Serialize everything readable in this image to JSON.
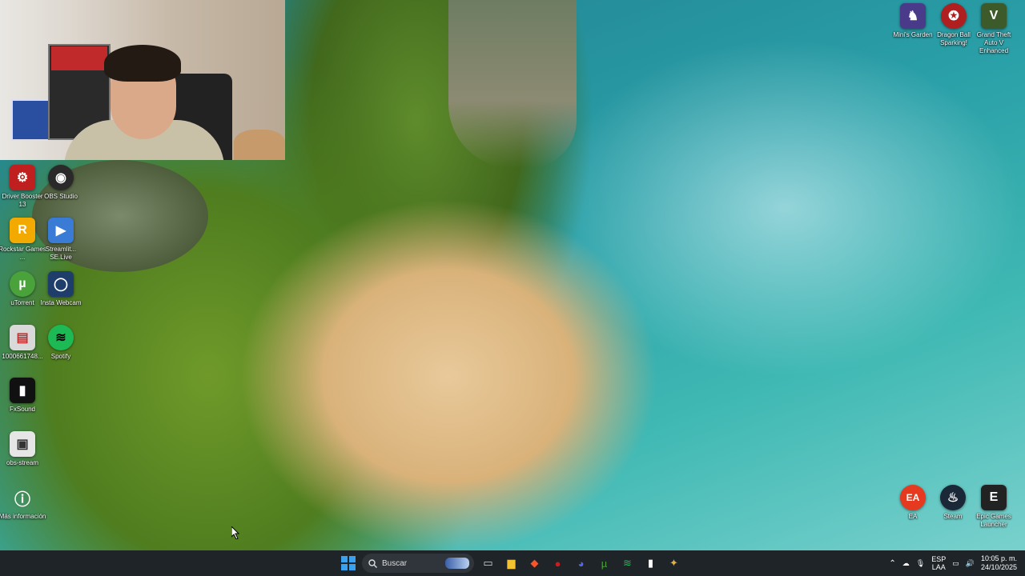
{
  "desktop_icons_left": [
    {
      "id": "driver-booster",
      "label": "Driver Booster 13",
      "icon": "gear-icon",
      "color": "#c01f1f",
      "glyph": "⚙"
    },
    {
      "id": "obs-studio",
      "label": "OBS Studio",
      "icon": "obs-icon",
      "color": "#2a2a2a",
      "glyph": "◉"
    },
    {
      "id": "rockstar",
      "label": "Rockstar Games ...",
      "icon": "rockstar-icon",
      "color": "#f2a900",
      "glyph": "R"
    },
    {
      "id": "streamlabs",
      "label": "Streamlit... SE.Live",
      "icon": "streamlabs-icon",
      "color": "#3a7bd5",
      "glyph": "▶"
    },
    {
      "id": "utorrent",
      "label": "uTorrent",
      "icon": "utorrent-icon",
      "color": "#4aa33a",
      "glyph": "µ"
    },
    {
      "id": "insta-webcam",
      "label": "Insta Webcam",
      "icon": "webcam-icon",
      "color": "#1f3d6b",
      "glyph": "◯"
    },
    {
      "id": "file-1000",
      "label": "1000661748...",
      "icon": "file-icon",
      "color": "#d9d9d9",
      "glyph": "▤"
    },
    {
      "id": "spotify",
      "label": "Spotify",
      "icon": "spotify-icon",
      "color": "#1db954",
      "glyph": "≋"
    },
    {
      "id": "fxsound",
      "label": "FxSound",
      "icon": "fxsound-icon",
      "color": "#111111",
      "glyph": "▮"
    },
    {
      "id": "obs-stream",
      "label": "obs-stream",
      "icon": "shortcut-icon",
      "color": "#e6e6e6",
      "glyph": "▣"
    },
    {
      "id": "mas-informacion",
      "label": "Más información",
      "icon": "info-icon",
      "color": "#555555",
      "glyph": "ⓘ"
    }
  ],
  "desktop_icons_right_top": [
    {
      "id": "mini-garden",
      "label": "Mini's Garden",
      "icon": "game-icon",
      "color": "#4a3a8a",
      "glyph": "♞"
    },
    {
      "id": "dragon-ball",
      "label": "Dragon Ball Sparking!",
      "icon": "dragonball-icon",
      "color": "#b01f1f",
      "glyph": "✪"
    },
    {
      "id": "gta-v",
      "label": "Grand Theft Auto V Enhanced",
      "icon": "gta-icon",
      "color": "#3c5a2a",
      "glyph": "V"
    }
  ],
  "desktop_icons_right_bottom": [
    {
      "id": "ea",
      "label": "EA",
      "icon": "ea-icon",
      "color": "#e53a1f",
      "glyph": "EA"
    },
    {
      "id": "steam",
      "label": "Steam",
      "icon": "steam-icon",
      "color": "#1b2838",
      "glyph": "♨"
    },
    {
      "id": "epic",
      "label": "Epic Games Launcher",
      "icon": "epic-icon",
      "color": "#222222",
      "glyph": "E"
    }
  ],
  "taskbar": {
    "search_placeholder": "Buscar",
    "apps": [
      {
        "id": "task-view",
        "icon": "task-view-icon",
        "glyph": "▭",
        "color": "#cfd6dc"
      },
      {
        "id": "file-explorer",
        "icon": "folder-icon",
        "glyph": "▆",
        "color": "#f2c230"
      },
      {
        "id": "brave",
        "icon": "brave-icon",
        "glyph": "◆",
        "color": "#fb542b"
      },
      {
        "id": "app-red",
        "icon": "app-red-icon",
        "glyph": "●",
        "color": "#c81e1e"
      },
      {
        "id": "discord",
        "icon": "discord-icon",
        "glyph": "◕",
        "color": "#5865f2"
      },
      {
        "id": "utorrent-tb",
        "icon": "utorrent-icon",
        "glyph": "µ",
        "color": "#4aa33a"
      },
      {
        "id": "spotify-tb",
        "icon": "spotify-icon",
        "glyph": "≋",
        "color": "#1db954"
      },
      {
        "id": "fxsound-tb",
        "icon": "fxsound-icon",
        "glyph": "▮",
        "color": "#ffffff"
      },
      {
        "id": "app-last",
        "icon": "app-icon",
        "glyph": "✦",
        "color": "#e0b040"
      }
    ],
    "tray": {
      "lang_top": "ESP",
      "lang_bottom": "LAA",
      "time": "10:05 p. m.",
      "date": "24/10/2025"
    }
  }
}
